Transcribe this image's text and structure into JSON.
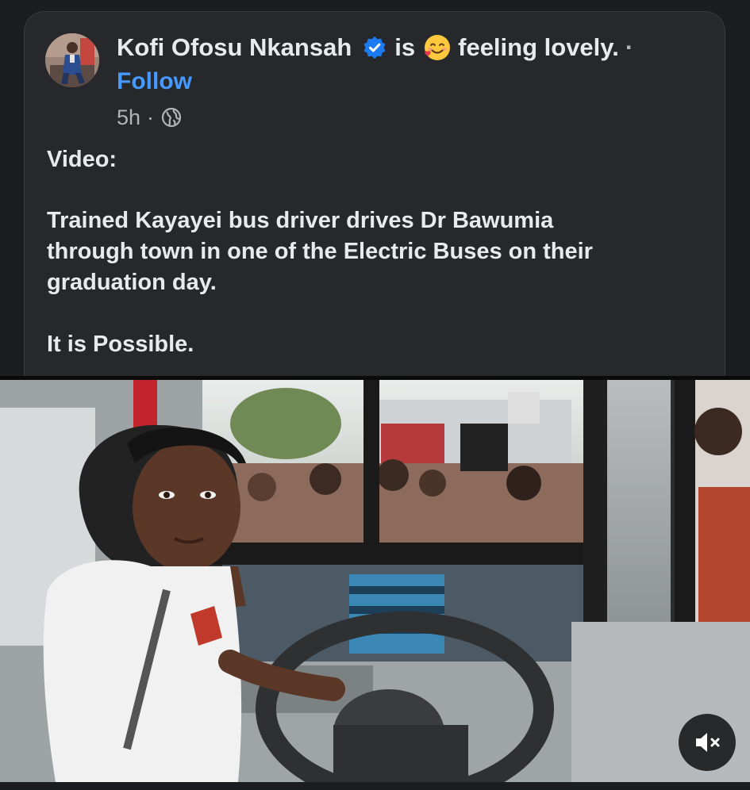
{
  "post": {
    "author": "Kofi Ofosu Nkansah",
    "is_label": "is",
    "feeling": "feeling lovely.",
    "separator": "·",
    "follow_label": "Follow",
    "time": "5h",
    "time_separator": "·",
    "lines": [
      "Video:",
      "Trained Kayayei bus driver drives Dr Bawumia",
      "through town in one of the Electric Buses on their",
      "graduation day.",
      "It is Possible."
    ]
  },
  "icons": {
    "verified": "verified-badge-icon",
    "feeling": "smiling-face-with-hearts-icon",
    "privacy": "globe-icon",
    "mute": "speaker-muted-icon"
  },
  "colors": {
    "background": "#1c1d20",
    "card": "#27282b",
    "link": "#4599ff",
    "verified": "#1d7bf2",
    "text": "#e8eaed",
    "muted_text": "#b0b3b8"
  }
}
